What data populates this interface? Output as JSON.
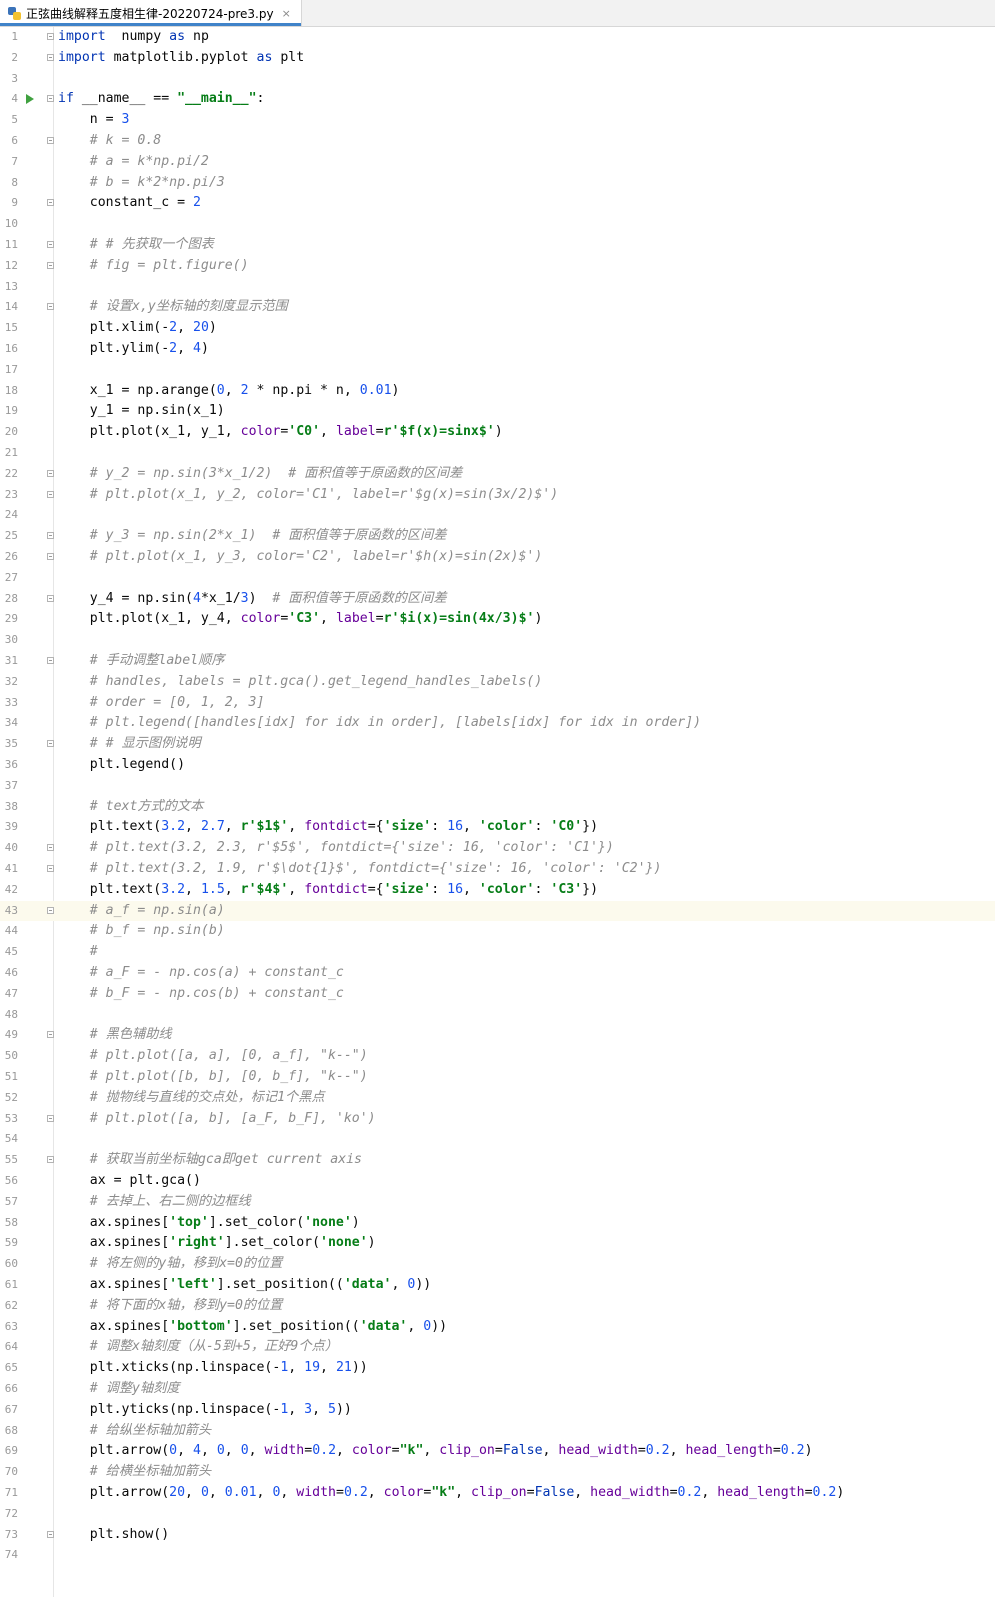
{
  "tab": {
    "filename": "正弦曲线解释五度相生律-20220724-pre3.py",
    "close_glyph": "×"
  },
  "fold_lines": [
    1,
    2,
    4,
    6,
    9,
    11,
    12,
    14,
    22,
    23,
    25,
    26,
    28,
    31,
    35,
    40,
    41,
    43,
    49,
    53,
    55,
    73
  ],
  "run_line": 4,
  "current_line": 43,
  "lines": [
    {
      "n": "1",
      "t": [
        [
          "kw",
          "import"
        ],
        [
          "",
          "  numpy "
        ],
        [
          "kw",
          "as"
        ],
        [
          "",
          " np"
        ]
      ]
    },
    {
      "n": "2",
      "t": [
        [
          "kw",
          "import"
        ],
        [
          "",
          " matplotlib.pyplot "
        ],
        [
          "kw",
          "as"
        ],
        [
          "",
          " plt"
        ]
      ]
    },
    {
      "n": "3",
      "t": []
    },
    {
      "n": "4",
      "t": [
        [
          "kw",
          "if"
        ],
        [
          "",
          " __name__ == "
        ],
        [
          "str",
          "\"__main__\""
        ],
        [
          "",
          ":"
        ]
      ]
    },
    {
      "n": "5",
      "t": [
        [
          "",
          "    n = "
        ],
        [
          "num",
          "3"
        ]
      ]
    },
    {
      "n": "6",
      "t": [
        [
          "cmt",
          "    # k = 0.8"
        ]
      ]
    },
    {
      "n": "7",
      "t": [
        [
          "cmt",
          "    # a = k*np.pi/2"
        ]
      ]
    },
    {
      "n": "8",
      "t": [
        [
          "cmt",
          "    # b = k*2*np.pi/3"
        ]
      ]
    },
    {
      "n": "9",
      "t": [
        [
          "",
          "    constant_c = "
        ],
        [
          "num",
          "2"
        ]
      ]
    },
    {
      "n": "10",
      "t": []
    },
    {
      "n": "11",
      "t": [
        [
          "cmt",
          "    # # 先获取一个图表"
        ]
      ]
    },
    {
      "n": "12",
      "t": [
        [
          "cmt",
          "    # fig = plt.figure()"
        ]
      ]
    },
    {
      "n": "13",
      "t": []
    },
    {
      "n": "14",
      "t": [
        [
          "cmt",
          "    # 设置x,y坐标轴的刻度显示范围"
        ]
      ]
    },
    {
      "n": "15",
      "t": [
        [
          "",
          "    plt.xlim(-"
        ],
        [
          "num",
          "2"
        ],
        [
          "",
          ", "
        ],
        [
          "num",
          "20"
        ],
        [
          "",
          ")"
        ]
      ]
    },
    {
      "n": "16",
      "t": [
        [
          "",
          "    plt.ylim(-"
        ],
        [
          "num",
          "2"
        ],
        [
          "",
          ", "
        ],
        [
          "num",
          "4"
        ],
        [
          "",
          ")"
        ]
      ]
    },
    {
      "n": "17",
      "t": []
    },
    {
      "n": "18",
      "t": [
        [
          "",
          "    x_1 = np.arange("
        ],
        [
          "num",
          "0"
        ],
        [
          "",
          ", "
        ],
        [
          "num",
          "2"
        ],
        [
          "",
          " * np.pi * n, "
        ],
        [
          "num",
          "0.01"
        ],
        [
          "",
          ")"
        ]
      ]
    },
    {
      "n": "19",
      "t": [
        [
          "",
          "    y_1 = np.sin(x_1)"
        ]
      ]
    },
    {
      "n": "20",
      "t": [
        [
          "",
          "    plt.plot(x_1, y_1, "
        ],
        [
          "kwa",
          "color"
        ],
        [
          "",
          "="
        ],
        [
          "str",
          "'C0'"
        ],
        [
          "",
          ", "
        ],
        [
          "kwa",
          "label"
        ],
        [
          "",
          "="
        ],
        [
          "str",
          "r'$f(x)=sinx$'"
        ],
        [
          "",
          ")"
        ]
      ]
    },
    {
      "n": "21",
      "t": []
    },
    {
      "n": "22",
      "t": [
        [
          "cmt",
          "    # y_2 = np.sin(3*x_1/2)  # 面积值等于原函数的区间差"
        ]
      ]
    },
    {
      "n": "23",
      "t": [
        [
          "cmt",
          "    # plt.plot(x_1, y_2, color='C1', label=r'$g(x)=sin(3x/2)$')"
        ]
      ]
    },
    {
      "n": "24",
      "t": []
    },
    {
      "n": "25",
      "t": [
        [
          "cmt",
          "    # y_3 = np.sin(2*x_1)  # 面积值等于原函数的区间差"
        ]
      ]
    },
    {
      "n": "26",
      "t": [
        [
          "cmt",
          "    # plt.plot(x_1, y_3, color='C2', label=r'$h(x)=sin(2x)$')"
        ]
      ]
    },
    {
      "n": "27",
      "t": []
    },
    {
      "n": "28",
      "t": [
        [
          "",
          "    y_4 = np.sin("
        ],
        [
          "num",
          "4"
        ],
        [
          "",
          "*x_1/"
        ],
        [
          "num",
          "3"
        ],
        [
          "",
          ")  "
        ],
        [
          "cmt",
          "# 面积值等于原函数的区间差"
        ]
      ]
    },
    {
      "n": "29",
      "t": [
        [
          "",
          "    plt.plot(x_1, y_4, "
        ],
        [
          "kwa",
          "color"
        ],
        [
          "",
          "="
        ],
        [
          "str",
          "'C3'"
        ],
        [
          "",
          ", "
        ],
        [
          "kwa",
          "label"
        ],
        [
          "",
          "="
        ],
        [
          "str",
          "r'$i(x)=sin(4x/3)$'"
        ],
        [
          "",
          ")"
        ]
      ]
    },
    {
      "n": "30",
      "t": []
    },
    {
      "n": "31",
      "t": [
        [
          "cmt",
          "    # 手动调整label顺序"
        ]
      ]
    },
    {
      "n": "32",
      "t": [
        [
          "cmt",
          "    # handles, labels = plt.gca().get_legend_handles_labels()"
        ]
      ]
    },
    {
      "n": "33",
      "t": [
        [
          "cmt",
          "    # order = [0, 1, 2, 3]"
        ]
      ]
    },
    {
      "n": "34",
      "t": [
        [
          "cmt",
          "    # plt.legend([handles[idx] for idx in order], [labels[idx] for idx in order])"
        ]
      ]
    },
    {
      "n": "35",
      "t": [
        [
          "cmt",
          "    # # 显示图例说明"
        ]
      ]
    },
    {
      "n": "36",
      "t": [
        [
          "",
          "    plt.legend()"
        ]
      ]
    },
    {
      "n": "37",
      "t": []
    },
    {
      "n": "38",
      "t": [
        [
          "cmt",
          "    # text方式的文本"
        ]
      ]
    },
    {
      "n": "39",
      "t": [
        [
          "",
          "    plt.text("
        ],
        [
          "num",
          "3.2"
        ],
        [
          "",
          ", "
        ],
        [
          "num",
          "2.7"
        ],
        [
          "",
          ", "
        ],
        [
          "str",
          "r'$1$'"
        ],
        [
          "",
          ", "
        ],
        [
          "kwa",
          "fontdict"
        ],
        [
          "",
          "={"
        ],
        [
          "str",
          "'size'"
        ],
        [
          "",
          ": "
        ],
        [
          "num",
          "16"
        ],
        [
          "",
          ", "
        ],
        [
          "str",
          "'color'"
        ],
        [
          "",
          ": "
        ],
        [
          "str",
          "'C0'"
        ],
        [
          "",
          "})"
        ]
      ]
    },
    {
      "n": "40",
      "t": [
        [
          "cmt",
          "    # plt.text(3.2, 2.3, r'$5$', fontdict={'size': 16, 'color': 'C1'})"
        ]
      ]
    },
    {
      "n": "41",
      "t": [
        [
          "cmt",
          "    # plt.text(3.2, 1.9, r'$\\dot{1}$', fontdict={'size': 16, 'color': 'C2'})"
        ]
      ]
    },
    {
      "n": "42",
      "t": [
        [
          "",
          "    plt.text("
        ],
        [
          "num",
          "3.2"
        ],
        [
          "",
          ", "
        ],
        [
          "num",
          "1.5"
        ],
        [
          "",
          ", "
        ],
        [
          "str",
          "r'$4$'"
        ],
        [
          "",
          ", "
        ],
        [
          "kwa",
          "fontdict"
        ],
        [
          "",
          "={"
        ],
        [
          "str",
          "'size'"
        ],
        [
          "",
          ": "
        ],
        [
          "num",
          "16"
        ],
        [
          "",
          ", "
        ],
        [
          "str",
          "'color'"
        ],
        [
          "",
          ": "
        ],
        [
          "str",
          "'C3'"
        ],
        [
          "",
          "})"
        ]
      ]
    },
    {
      "n": "43",
      "t": [
        [
          "cmt",
          "    # a_f = np.sin(a)"
        ]
      ]
    },
    {
      "n": "44",
      "t": [
        [
          "cmt",
          "    # b_f = np.sin(b)"
        ]
      ]
    },
    {
      "n": "45",
      "t": [
        [
          "cmt",
          "    #"
        ]
      ]
    },
    {
      "n": "46",
      "t": [
        [
          "cmt",
          "    # a_F = - np.cos(a) + constant_c"
        ]
      ]
    },
    {
      "n": "47",
      "t": [
        [
          "cmt",
          "    # b_F = - np.cos(b) + constant_c"
        ]
      ]
    },
    {
      "n": "48",
      "t": []
    },
    {
      "n": "49",
      "t": [
        [
          "cmt",
          "    # 黑色辅助线"
        ]
      ]
    },
    {
      "n": "50",
      "t": [
        [
          "cmt",
          "    # plt.plot([a, a], [0, a_f], \"k--\")"
        ]
      ]
    },
    {
      "n": "51",
      "t": [
        [
          "cmt",
          "    # plt.plot([b, b], [0, b_f], \"k--\")"
        ]
      ]
    },
    {
      "n": "52",
      "t": [
        [
          "cmt",
          "    # 抛物线与直线的交点处，标记1个黑点"
        ]
      ]
    },
    {
      "n": "53",
      "t": [
        [
          "cmt",
          "    # plt.plot([a, b], [a_F, b_F], 'ko')"
        ]
      ]
    },
    {
      "n": "54",
      "t": []
    },
    {
      "n": "55",
      "t": [
        [
          "cmt",
          "    # 获取当前坐标轴gca即get current axis"
        ]
      ]
    },
    {
      "n": "56",
      "t": [
        [
          "",
          "    ax = plt.gca()"
        ]
      ]
    },
    {
      "n": "57",
      "t": [
        [
          "cmt",
          "    # 去掉上、右二侧的边框线"
        ]
      ]
    },
    {
      "n": "58",
      "t": [
        [
          "",
          "    ax.spines["
        ],
        [
          "str",
          "'top'"
        ],
        [
          "",
          "].set_color("
        ],
        [
          "str",
          "'none'"
        ],
        [
          "",
          ")"
        ]
      ]
    },
    {
      "n": "59",
      "t": [
        [
          "",
          "    ax.spines["
        ],
        [
          "str",
          "'right'"
        ],
        [
          "",
          "].set_color("
        ],
        [
          "str",
          "'none'"
        ],
        [
          "",
          ")"
        ]
      ]
    },
    {
      "n": "60",
      "t": [
        [
          "cmt",
          "    # 将左侧的y轴，移到x=0的位置"
        ]
      ]
    },
    {
      "n": "61",
      "t": [
        [
          "",
          "    ax.spines["
        ],
        [
          "str",
          "'left'"
        ],
        [
          "",
          "].set_position(("
        ],
        [
          "str",
          "'data'"
        ],
        [
          "",
          ", "
        ],
        [
          "num",
          "0"
        ],
        [
          "",
          "))"
        ]
      ]
    },
    {
      "n": "62",
      "t": [
        [
          "cmt",
          "    # 将下面的x轴，移到y=0的位置"
        ]
      ]
    },
    {
      "n": "63",
      "t": [
        [
          "",
          "    ax.spines["
        ],
        [
          "str",
          "'bottom'"
        ],
        [
          "",
          "].set_position(("
        ],
        [
          "str",
          "'data'"
        ],
        [
          "",
          ", "
        ],
        [
          "num",
          "0"
        ],
        [
          "",
          "))"
        ]
      ]
    },
    {
      "n": "64",
      "t": [
        [
          "cmt",
          "    # 调整x轴刻度（从-5到+5，正好9个点）"
        ]
      ]
    },
    {
      "n": "65",
      "t": [
        [
          "",
          "    plt.xticks(np.linspace(-"
        ],
        [
          "num",
          "1"
        ],
        [
          "",
          ", "
        ],
        [
          "num",
          "19"
        ],
        [
          "",
          ", "
        ],
        [
          "num",
          "21"
        ],
        [
          "",
          "))"
        ]
      ]
    },
    {
      "n": "66",
      "t": [
        [
          "cmt",
          "    # 调整y轴刻度"
        ]
      ]
    },
    {
      "n": "67",
      "t": [
        [
          "",
          "    plt.yticks(np.linspace(-"
        ],
        [
          "num",
          "1"
        ],
        [
          "",
          ", "
        ],
        [
          "num",
          "3"
        ],
        [
          "",
          ", "
        ],
        [
          "num",
          "5"
        ],
        [
          "",
          "))"
        ]
      ]
    },
    {
      "n": "68",
      "t": [
        [
          "cmt",
          "    # 给纵坐标轴加箭头"
        ]
      ]
    },
    {
      "n": "69",
      "t": [
        [
          "",
          "    plt.arrow("
        ],
        [
          "num",
          "0"
        ],
        [
          "",
          ", "
        ],
        [
          "num",
          "4"
        ],
        [
          "",
          ", "
        ],
        [
          "num",
          "0"
        ],
        [
          "",
          ", "
        ],
        [
          "num",
          "0"
        ],
        [
          "",
          ", "
        ],
        [
          "kwa",
          "width"
        ],
        [
          "",
          "="
        ],
        [
          "num",
          "0.2"
        ],
        [
          "",
          ", "
        ],
        [
          "kwa",
          "color"
        ],
        [
          "",
          "="
        ],
        [
          "str",
          "\"k\""
        ],
        [
          "",
          ", "
        ],
        [
          "kwa",
          "clip_on"
        ],
        [
          "",
          "="
        ],
        [
          "kw",
          "False"
        ],
        [
          "",
          ", "
        ],
        [
          "kwa",
          "head_width"
        ],
        [
          "",
          "="
        ],
        [
          "num",
          "0.2"
        ],
        [
          "",
          ", "
        ],
        [
          "kwa",
          "head_length"
        ],
        [
          "",
          "="
        ],
        [
          "num",
          "0.2"
        ],
        [
          "",
          ")"
        ]
      ]
    },
    {
      "n": "70",
      "t": [
        [
          "cmt",
          "    # 给横坐标轴加箭头"
        ]
      ]
    },
    {
      "n": "71",
      "t": [
        [
          "",
          "    plt.arrow("
        ],
        [
          "num",
          "20"
        ],
        [
          "",
          ", "
        ],
        [
          "num",
          "0"
        ],
        [
          "",
          ", "
        ],
        [
          "num",
          "0.01"
        ],
        [
          "",
          ", "
        ],
        [
          "num",
          "0"
        ],
        [
          "",
          ", "
        ],
        [
          "kwa",
          "width"
        ],
        [
          "",
          "="
        ],
        [
          "num",
          "0.2"
        ],
        [
          "",
          ", "
        ],
        [
          "kwa",
          "color"
        ],
        [
          "",
          "="
        ],
        [
          "str",
          "\"k\""
        ],
        [
          "",
          ", "
        ],
        [
          "kwa",
          "clip_on"
        ],
        [
          "",
          "="
        ],
        [
          "kw",
          "False"
        ],
        [
          "",
          ", "
        ],
        [
          "kwa",
          "head_width"
        ],
        [
          "",
          "="
        ],
        [
          "num",
          "0.2"
        ],
        [
          "",
          ", "
        ],
        [
          "kwa",
          "head_length"
        ],
        [
          "",
          "="
        ],
        [
          "num",
          "0.2"
        ],
        [
          "",
          ")"
        ]
      ]
    },
    {
      "n": "72",
      "t": []
    },
    {
      "n": "73",
      "t": [
        [
          "",
          "    plt.show()"
        ]
      ]
    },
    {
      "n": "74",
      "t": []
    }
  ]
}
